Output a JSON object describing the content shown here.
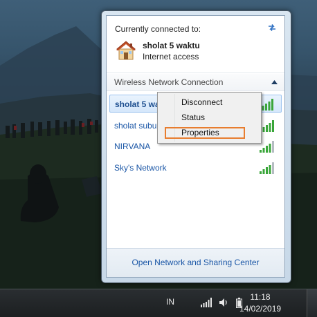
{
  "flyout": {
    "connected_title": "Currently connected to:",
    "current_network": {
      "name": "sholat 5 waktu",
      "status": "Internet access"
    },
    "section_header": "Wireless Network Connection",
    "networks": [
      {
        "name": "sholat 5 waktu",
        "display": "sholat 5 wa",
        "selected": true,
        "signal_bars": 5
      },
      {
        "name": "sholat subuh",
        "display": "sholat subul",
        "selected": false,
        "signal_bars": 5
      },
      {
        "name": "NIRVANA",
        "display": "NIRVANA",
        "selected": false,
        "signal_bars": 4
      },
      {
        "name": "Sky's Network",
        "display": "Sky's Network",
        "selected": false,
        "signal_bars": 4
      }
    ],
    "footer_link": "Open Network and Sharing Center"
  },
  "context_menu": {
    "items": [
      "Disconnect",
      "Status",
      "Properties"
    ],
    "highlighted": "Properties",
    "highlight_color": "#e87d2f"
  },
  "taskbar": {
    "language": "IN",
    "time": "11:18",
    "date": "14/02/2019",
    "tray_icons": [
      "network-signal-icon",
      "volume-icon",
      "battery-icon"
    ]
  },
  "colors": {
    "link": "#1a56a6",
    "selection": "#d5e7fb",
    "signal_green": "#3aa63a"
  }
}
